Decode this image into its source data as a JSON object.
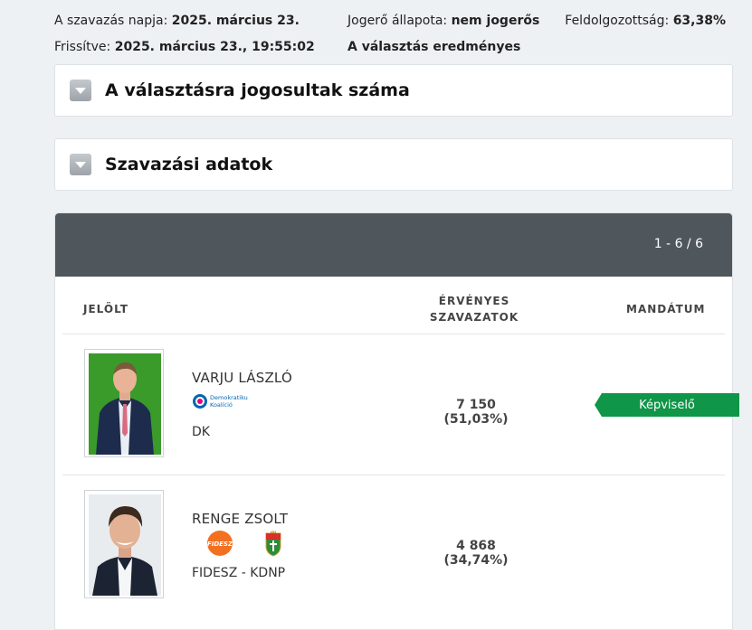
{
  "meta": {
    "vote_day_label": "A szavazás napja:",
    "vote_day": "2025. március 23.",
    "status_label": "Jogerő állapota:",
    "status": "nem jogerős",
    "progress_label": "Feldolgozottság:",
    "progress": "63,38%",
    "updated_label": "Frissítve:",
    "updated": "2025. március 23., 19:55:02",
    "result_text": "A választás eredményes"
  },
  "panels": {
    "eligible_title": "A választásra jogosultak száma",
    "voting_title": "Szavazási adatok"
  },
  "results": {
    "pager": "1 - 6 / 6",
    "columns": {
      "candidate": "JELÖLT",
      "valid_votes_line1": "ÉRVÉNYES",
      "valid_votes_line2": "SZAVAZATOK",
      "mandate": "MANDÁTUM"
    },
    "rows": [
      {
        "name": "VARJU LÁSZLÓ",
        "party": "DK",
        "logo_text_1": "Demokratikus",
        "logo_text_2": "Koalíció",
        "votes": "7 150 (51,03%)",
        "mandate": "Képviselő",
        "photo_bg": "#3a9a2a"
      },
      {
        "name": "RENGE ZSOLT",
        "party": "FIDESZ - KDNP",
        "logo_text_1": "FIDESZ",
        "votes": "4 868 (34,74%)",
        "mandate": "",
        "photo_bg": "#e9ecee"
      }
    ]
  },
  "colors": {
    "header_bar": "#4f565c",
    "badge": "#0f9648",
    "fidesz": "#f37021"
  }
}
